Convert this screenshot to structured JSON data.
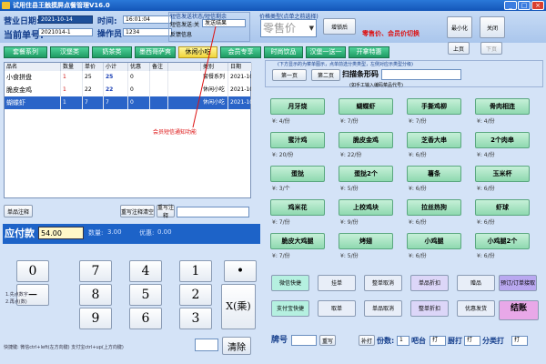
{
  "app": {
    "title": "试用住县王触摸屏点餐管理V16.0"
  },
  "header": {
    "date_label": "营业日期:",
    "date_value": "2021-10-14",
    "time_label": "时间:",
    "time_value": "16:01:04",
    "order_label": "当前单号:",
    "order_value": "2021014-1",
    "operator_label": "操作员:",
    "operator_value": "1234",
    "sms_title": "短信发送状态/短信剩余",
    "sms_send": "短信发送:关",
    "sms_result": "发送结果",
    "sms_feedback": "反馈信息",
    "price_type_label": "价格类型(点单之前选择)",
    "price_type_value": "零售价",
    "switch_btn": "增锁后",
    "annotation_price": "零售价、会员价切换",
    "minimize": "最小化",
    "close": "关闭"
  },
  "categories": [
    "套餐系列",
    "汉堡类",
    "奶茶类",
    "墨西哥萨爽",
    "休闲小吃",
    "会员专享",
    "时尚饮品",
    "汉堡一送一",
    "开拿特惠"
  ],
  "active_category": "休闲小吃",
  "grid": {
    "columns": [
      "品名",
      "数量",
      "单价",
      "小计",
      "优惠",
      "备注",
      "",
      "类别",
      "日期"
    ],
    "rows": [
      {
        "name": "小食拼盘",
        "qty": "1",
        "price": "25",
        "sub": "25",
        "disc": "0",
        "note": "",
        "cat": "套餐系列",
        "date": "2021-10-"
      },
      {
        "name": "脆皮金鸡",
        "qty": "1",
        "price": "22",
        "sub": "22",
        "disc": "0",
        "note": "",
        "cat": "休闲小吃",
        "date": "2021-10-"
      },
      {
        "name": "蝴蝶虾",
        "qty": "1",
        "price": "7",
        "sub": "7",
        "disc": "0",
        "note": "",
        "cat": "休闲小吃",
        "date": "2021-10-"
      }
    ]
  },
  "annotation_sms": "会员短信通知功能",
  "actions": {
    "single_note": "单品注释",
    "order_clear": "重写注释清空",
    "rewrite_note": "重写注释"
  },
  "payment": {
    "label": "应付款",
    "value": "54.00",
    "qty_label": "数量:",
    "qty_value": "3.00",
    "disc_label": "优惠:",
    "disc_value": "0.00"
  },
  "keypad": {
    "keys": [
      "0",
      "7",
      "4",
      "1",
      "•",
      "−",
      "8",
      "5",
      "2",
      "9",
      "6",
      "3"
    ],
    "multiply": "X(乘)",
    "clear": "清除",
    "tip1": "1.先点数字",
    "tip2": "2.再点(数)",
    "shortcut": "快捷键: 微信ctrl+left(左方向键) 支付宝ctrl+up(上方向键)"
  },
  "right": {
    "pager_hint": "(下方显示的为菜单图示，点单前选分类类型，左侧对应示类型分级)",
    "page1": "第一页",
    "page2": "第二页",
    "scan_label": "扫描条形码",
    "search_hint": "(如手工输入编码菜品代号)",
    "prev": "上页",
    "next": "下页",
    "dishes": [
      {
        "name": "月牙烧",
        "price": "¥: 4/份"
      },
      {
        "name": "蝴蝶虾",
        "price": "¥: 7/份"
      },
      {
        "name": "手撕鸡柳",
        "price": "¥: 7/份"
      },
      {
        "name": "骨肉相连",
        "price": "¥: 4/份"
      },
      {
        "name": "蜜汁鸡",
        "price": "¥: 20/份"
      },
      {
        "name": "脆皮金鸡",
        "price": "¥: 22/份"
      },
      {
        "name": "芝香大串",
        "price": "¥: 6/份"
      },
      {
        "name": "2个肉串",
        "price": "¥: 4/份"
      },
      {
        "name": "蛋挞",
        "price": "¥: 3/个"
      },
      {
        "name": "蛋挞2个",
        "price": "¥: 5/份"
      },
      {
        "name": "薯条",
        "price": "¥: 6/份"
      },
      {
        "name": "玉米杯",
        "price": "¥: 6/份"
      },
      {
        "name": "鸡米花",
        "price": "¥: 7/份"
      },
      {
        "name": "上校鸡块",
        "price": "¥: 9/份"
      },
      {
        "name": "拉丝热狗",
        "price": "¥: 6/份"
      },
      {
        "name": "虾球",
        "price": "¥: 6/份"
      },
      {
        "name": "脆皮大鸡腿",
        "price": "¥: 7/份"
      },
      {
        "name": "烤翅",
        "price": "¥: 5/份"
      },
      {
        "name": "小鸡腿",
        "price": "¥: 6/份"
      },
      {
        "name": "小鸡腿2个",
        "price": "¥: 6/份"
      }
    ],
    "funcs": [
      "微信快捷",
      "挂单",
      "整单取消",
      "单品折扣",
      "赠品",
      "预订/订单接取",
      "支付宝快捷",
      "取单",
      "单品取消",
      "整单折扣",
      "优惠发货",
      "结账"
    ],
    "table_label": "牌号",
    "rewrite": "重写",
    "copy": "补打",
    "people_label": "份数:",
    "people_value": "1",
    "bar_label": "吧台",
    "bar_value": "打",
    "kitchen_label": "厨打",
    "kitchen_value": "打",
    "split_label": "分类打",
    "split_value": "打"
  }
}
